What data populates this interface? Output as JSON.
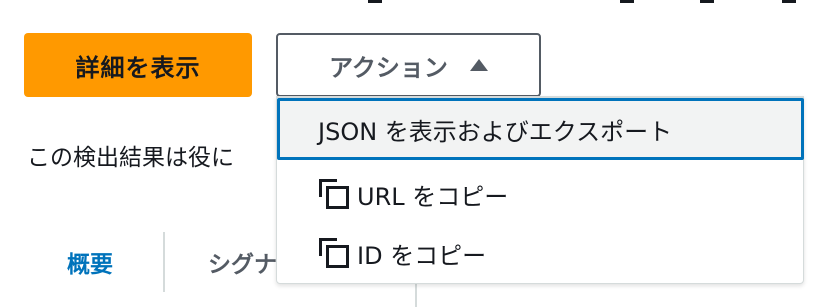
{
  "toolbar": {
    "details_label": "詳細を表示",
    "actions_label": "アクション"
  },
  "description": {
    "text": "この検出結果は役に"
  },
  "tabs": [
    {
      "label": "概要"
    },
    {
      "label": "シグナ"
    }
  ],
  "actions_menu": {
    "items": [
      {
        "label": "JSON を表示およびエクスポート",
        "icon": ""
      },
      {
        "label": "URL をコピー",
        "icon": "copy-icon"
      },
      {
        "label": "ID をコピー",
        "icon": "copy-icon"
      }
    ]
  },
  "colors": {
    "primary_button": "#ff9900",
    "active_tab": "#0073bb",
    "focus_border": "#0073bb",
    "highlight_bg": "#f2f3f3"
  }
}
